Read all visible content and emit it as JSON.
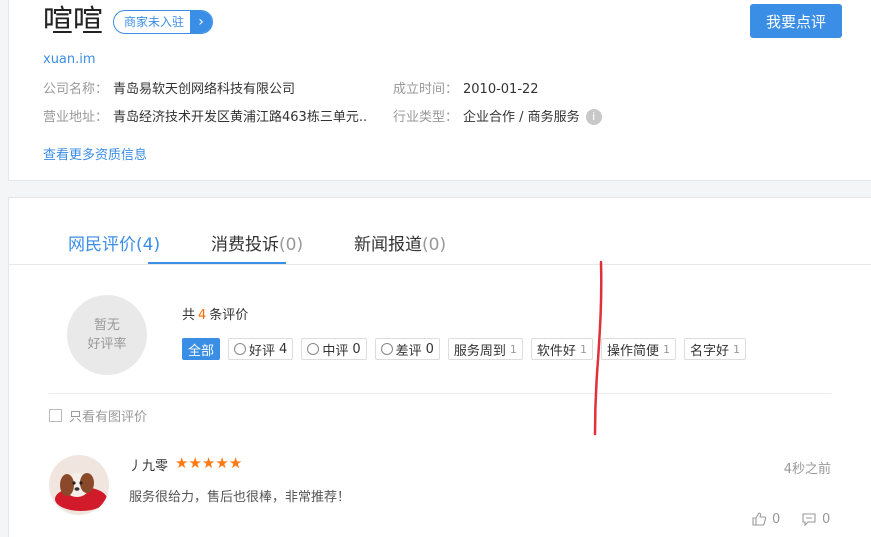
{
  "company": {
    "name": "喧喧",
    "merchant_badge": "商家未入驻",
    "review_button": "我要点评",
    "site": "xuan.im",
    "info": {
      "company_name_label": "公司名称：",
      "company_name": "青岛易软天创网络科技有限公司",
      "established_label": "成立时间：",
      "established": "2010-01-22",
      "address_label": "营业地址：",
      "address": "青岛经济技术开发区黄浦江路463栋三单元..",
      "industry_label": "行业类型：",
      "industry": "企业合作 / 商务服务"
    },
    "more_link": "查看更多资质信息"
  },
  "tabs": [
    {
      "label": "网民评价",
      "count": "(4)"
    },
    {
      "label": "消费投诉",
      "count": "(0)"
    },
    {
      "label": "新闻报道",
      "count": "(0)"
    }
  ],
  "rating": {
    "line1": "暂无",
    "line2": "好评率"
  },
  "summary": {
    "prefix": "共",
    "count": "4",
    "suffix": "条评价"
  },
  "filters": [
    {
      "label": "全部",
      "count": ""
    },
    {
      "label": "好评",
      "count": "4"
    },
    {
      "label": "中评",
      "count": "0"
    },
    {
      "label": "差评",
      "count": "0"
    },
    {
      "label": "服务周到",
      "count": "1"
    },
    {
      "label": "软件好",
      "count": "1"
    },
    {
      "label": "操作简便",
      "count": "1"
    },
    {
      "label": "名字好",
      "count": "1"
    }
  ],
  "only_pictures": "只看有图评价",
  "review": {
    "user": "丿九零",
    "stars": 5,
    "time": "4秒之前",
    "text": "服务很给力，售后也很棒，非常推荐！",
    "likes": "0",
    "comments": "0"
  },
  "colors": {
    "accent": "#3a8ee6",
    "star": "#ff7a14",
    "count_highlight": "#ff6a00",
    "annotation": "#e0303a"
  }
}
